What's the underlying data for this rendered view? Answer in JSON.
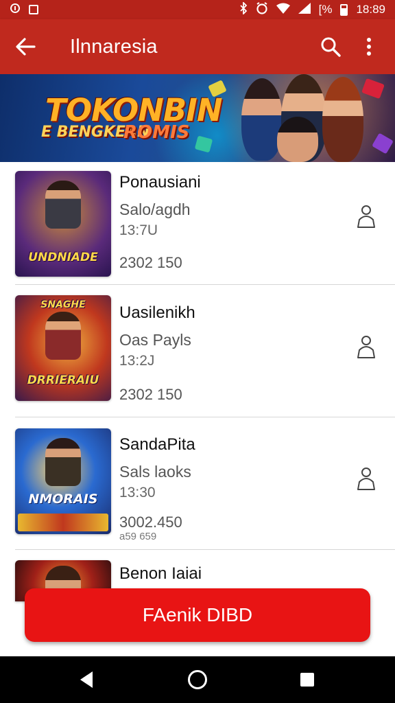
{
  "status_bar": {
    "left_icons": [
      "notification-icon",
      "app-icon"
    ],
    "right_icons": [
      "bluetooth-icon",
      "alarm-icon",
      "wifi-icon",
      "signal-icon"
    ],
    "battery_text": "[%",
    "time": "18:89"
  },
  "app_bar": {
    "title": "Ilnnaresia",
    "back_icon": "arrow-left-icon",
    "search_icon": "search-icon",
    "menu_icon": "more-vert-icon"
  },
  "banner": {
    "title": "TOKONBIN",
    "subtitle_left": "E BENGKEAN",
    "subtitle_right": "ROMIS"
  },
  "items": [
    {
      "title": "Ponausiani",
      "subtitle": "Salo/agdh",
      "code": "13:7U",
      "numbers": "2302 150",
      "thumb_label": "UNDNIADE",
      "thumb_top_label": "",
      "icon": "person-outline-icon"
    },
    {
      "title": "Uasilenikh",
      "subtitle": "Oas Payls",
      "code": "13:2J",
      "numbers": "2302 150",
      "thumb_label": "DRRIERAIU",
      "thumb_top_label": "SNAGHE",
      "icon": "person-outline-icon"
    },
    {
      "title": "SandaPita",
      "subtitle": "Sals laoks",
      "code": "13:30",
      "numbers": "3002.450",
      "extra": "a59 659",
      "thumb_label": "NMORAIS",
      "thumb_top_label": "",
      "icon": "person-outline-icon"
    },
    {
      "title": "Benon Iaiai",
      "subtitle": "",
      "code": "",
      "numbers": "",
      "thumb_label": "",
      "thumb_top_label": "",
      "icon": ""
    }
  ],
  "cta": {
    "label": "FAenik DIBD"
  },
  "nav": {
    "back": "back-triangle-icon",
    "home": "home-circle-icon",
    "recents": "recents-square-icon"
  },
  "colors": {
    "app_bar": "#c0291e",
    "status_bar": "#b5231a",
    "cta": "#e81414"
  }
}
